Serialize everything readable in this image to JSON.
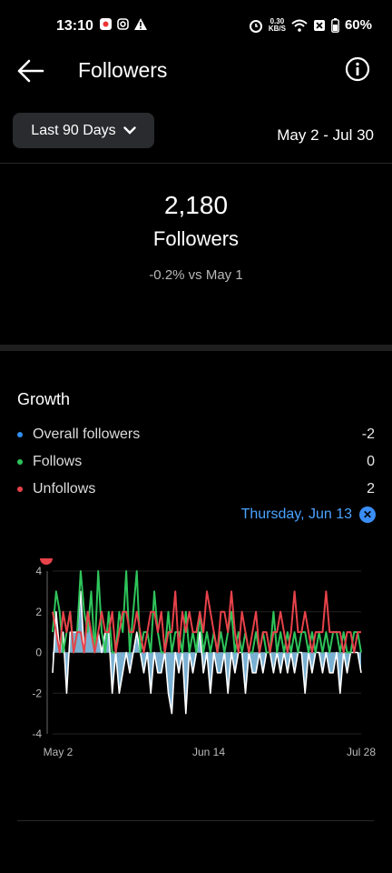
{
  "status_bar": {
    "time": "13:10",
    "speed_value": "0.30",
    "speed_unit": "KB/S",
    "battery": "60%"
  },
  "header": {
    "title": "Followers",
    "back_icon": "arrow-left-icon",
    "info_icon": "info-icon"
  },
  "filter": {
    "range_label": "Last 90 Days",
    "date_range": "May 2 - Jul 30"
  },
  "summary": {
    "count": "2,180",
    "label": "Followers",
    "change": "-0.2% vs May 1"
  },
  "growth": {
    "title": "Growth",
    "legend": [
      {
        "label": "Overall followers",
        "value": "-2",
        "color": "#2f8ff0"
      },
      {
        "label": "Follows",
        "value": "0",
        "color": "#2ec45a"
      },
      {
        "label": "Unfollows",
        "value": "2",
        "color": "#e8424a"
      }
    ],
    "selected_date": "Thursday, Jun 13"
  },
  "chart_data": {
    "type": "line",
    "title": "",
    "x_tick_labels": [
      "May 2",
      "Jun 14",
      "Jul 28"
    ],
    "y_tick_labels": [
      "4",
      "2",
      "0",
      "-2",
      "-4"
    ],
    "ylim": [
      -4,
      4
    ],
    "series": [
      {
        "name": "Overall followers",
        "color": "#a9d8f5",
        "values": [
          -1,
          2,
          0,
          1,
          -2,
          1,
          1,
          1,
          3,
          0,
          2,
          1,
          0,
          1,
          0,
          1,
          1,
          -2,
          0,
          -2,
          -1,
          0,
          -1,
          0,
          1,
          0,
          -1,
          0,
          -2,
          0,
          -1,
          -1,
          0,
          -2,
          -3,
          0,
          -1,
          0,
          -3,
          0,
          -1,
          0,
          1,
          -1,
          0,
          -2,
          0,
          -1,
          -1,
          0,
          -2,
          0,
          -1,
          0,
          0,
          -2,
          0,
          -1,
          -1,
          0,
          -1,
          0,
          0,
          -1,
          0,
          -1,
          0,
          -1,
          0,
          -1,
          0,
          0,
          -2,
          0,
          -1,
          0,
          0,
          -1,
          0,
          -1,
          -1,
          0,
          -2,
          0,
          -1,
          0,
          0,
          0,
          -1
        ]
      },
      {
        "name": "Follows",
        "color": "#2ec45a",
        "values": [
          1,
          3,
          2,
          0,
          1,
          2,
          0,
          1,
          4,
          2,
          1,
          3,
          0,
          4,
          1,
          0,
          2,
          0,
          0,
          2,
          1,
          4,
          0,
          2,
          4,
          0,
          1,
          1,
          0,
          3,
          1,
          0,
          0,
          2,
          0,
          1,
          1,
          0,
          2,
          0,
          1,
          0,
          2,
          0,
          1,
          0,
          1,
          0,
          1,
          0,
          1,
          2,
          0,
          1,
          0,
          1,
          0,
          0,
          1,
          0,
          1,
          0,
          0,
          2,
          0,
          1,
          0,
          1,
          0,
          1,
          0,
          1,
          1,
          0,
          1,
          0,
          1,
          0,
          1,
          0,
          1,
          1,
          0,
          1,
          0,
          0,
          1,
          1,
          0
        ]
      },
      {
        "name": "Unfollows",
        "color": "#e8424a",
        "values": [
          2,
          1,
          0,
          2,
          1,
          2,
          0,
          1,
          1,
          0,
          2,
          1,
          0,
          1,
          2,
          1,
          1,
          2,
          0,
          1,
          2,
          2,
          1,
          1,
          2,
          1,
          0,
          1,
          2,
          2,
          1,
          2,
          0,
          1,
          1,
          3,
          0,
          2,
          1,
          2,
          1,
          1,
          2,
          1,
          3,
          2,
          1,
          0,
          2,
          2,
          1,
          3,
          1,
          0,
          2,
          1,
          0,
          1,
          2,
          0,
          1,
          1,
          0,
          1,
          1,
          2,
          1,
          0,
          1,
          3,
          1,
          1,
          2,
          1,
          0,
          1,
          1,
          1,
          3,
          1,
          1,
          1,
          1,
          0,
          1,
          1,
          0,
          1,
          1
        ]
      }
    ]
  }
}
